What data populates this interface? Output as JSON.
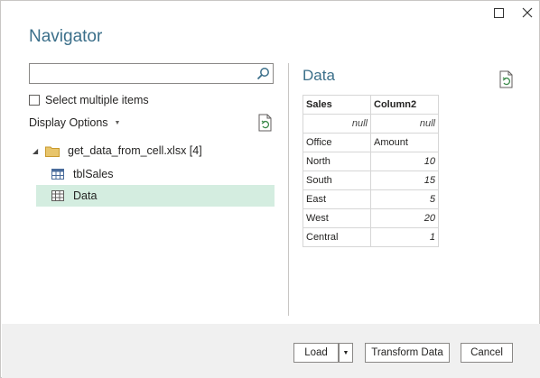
{
  "dialog": {
    "title": "Navigator",
    "window_controls": [
      "maximize-icon",
      "close-icon"
    ]
  },
  "left": {
    "search": {
      "value": "",
      "placeholder": ""
    },
    "select_multiple_label": "Select multiple items",
    "select_multiple_checked": false,
    "display_options_label": "Display Options",
    "tree": {
      "root": {
        "label": "get_data_from_cell.xlsx [4]",
        "expanded": true
      },
      "items": [
        {
          "label": "tblSales",
          "icon": "table-icon",
          "selected": false
        },
        {
          "label": "Data",
          "icon": "sheet-icon",
          "selected": true
        }
      ]
    }
  },
  "preview": {
    "title": "Data",
    "columns": [
      "Sales",
      "Column2"
    ],
    "rows": [
      [
        "null",
        "null"
      ],
      [
        "Office",
        "Amount"
      ],
      [
        "North",
        "10"
      ],
      [
        "South",
        "15"
      ],
      [
        "East",
        "5"
      ],
      [
        "West",
        "20"
      ],
      [
        "Central",
        "1"
      ]
    ]
  },
  "footer": {
    "load_label": "Load",
    "transform_label": "Transform Data",
    "cancel_label": "Cancel"
  },
  "colors": {
    "title": "#3b6f8a",
    "selected_bg": "#d4ede0",
    "footer_bg": "#f0f0f0",
    "refresh_accent": "#3c8a4a"
  }
}
